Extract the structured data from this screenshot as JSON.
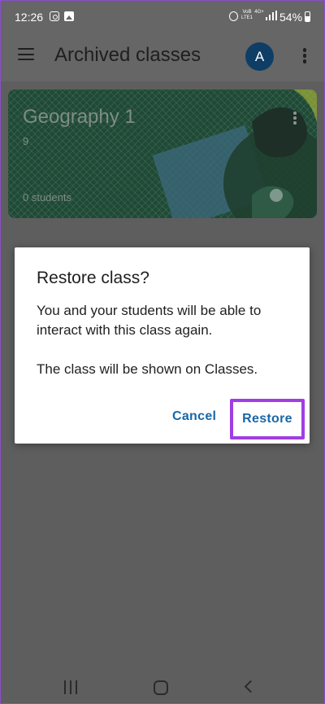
{
  "status_bar": {
    "time": "12:26",
    "network_top": "VoB",
    "network_bottom": "LTE1",
    "network_type": "4G+",
    "battery_percent": "54%",
    "battery_level": 0.54,
    "icons": [
      "instagram-icon",
      "gallery-icon",
      "alarm-icon",
      "signal-icon",
      "battery-icon"
    ]
  },
  "app_bar": {
    "title": "Archived classes",
    "avatar_initial": "A",
    "avatar_color": "#0e3e66",
    "menu_icon": "hamburger-menu-icon",
    "more_icon": "more-vert-icon"
  },
  "class_card": {
    "name": "Geography 1",
    "section": "9",
    "students": "0 students",
    "theme_color": "#1f4a36"
  },
  "dialog": {
    "title": "Restore class?",
    "body_line1": "You and your students will be able to interact with this class again.",
    "body_line2": "The class will be shown on Classes.",
    "cancel_label": "Cancel",
    "restore_label": "Restore",
    "button_color": "#1967a8",
    "highlight_color": "#a03ee3"
  },
  "nav_bar": {
    "icons": [
      "recents-icon",
      "home-icon",
      "back-icon"
    ]
  }
}
